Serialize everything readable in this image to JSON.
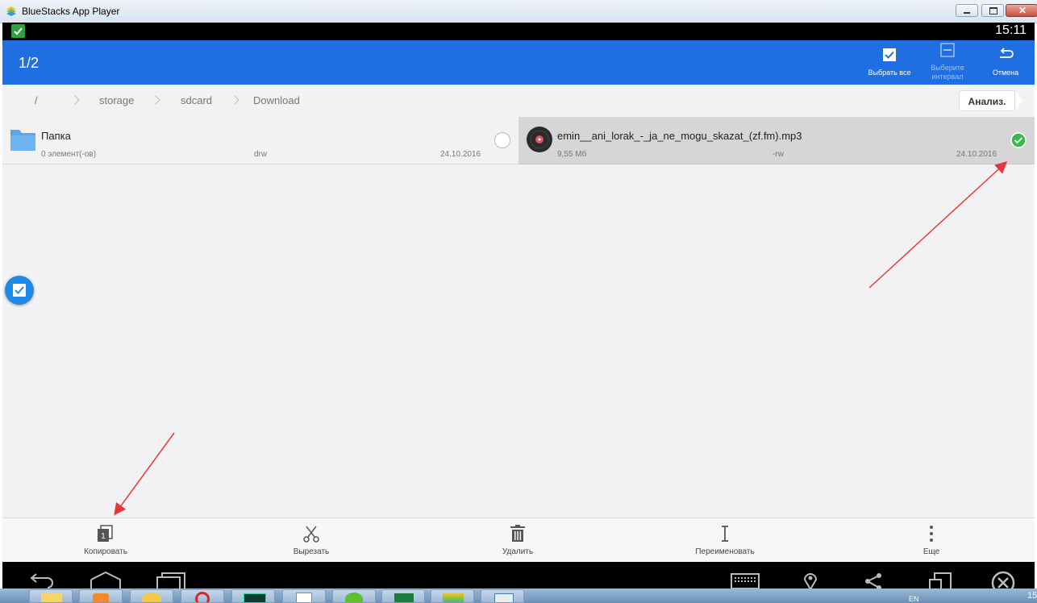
{
  "window": {
    "title": "BlueStacks App Player"
  },
  "statusbar": {
    "time": "15:11"
  },
  "actionbar": {
    "selection_count": "1/2",
    "select_all_label": "Выбрать все",
    "select_interval_label_1": "Выберите",
    "select_interval_label_2": "интервал",
    "cancel_label": "Отмена",
    "color": "#1f6fe2"
  },
  "breadcrumb": {
    "items": [
      "/",
      "storage",
      "sdcard",
      "Download"
    ],
    "analyze_label": "Анализ."
  },
  "files": [
    {
      "name": "Папка",
      "info": "0 элемент(-ов)",
      "perms": "drw",
      "date": "24.10.2016",
      "selected": false,
      "icon": "folder-icon"
    },
    {
      "name": "emin__ani_lorak_-_ja_ne_mogu_skazat_(zf.fm).mp3",
      "info": "9,55 Мб",
      "perms": "-rw",
      "date": "24.10.2016",
      "selected": true,
      "icon": "music-disc-icon"
    }
  ],
  "toolbar": {
    "copy_label": "Копировать",
    "copy_badge": "1",
    "cut_label": "Вырезать",
    "delete_label": "Удалить",
    "rename_label": "Переименовать",
    "more_label": "Еще"
  },
  "taskbar": {
    "lang": "EN",
    "clock": "15"
  }
}
